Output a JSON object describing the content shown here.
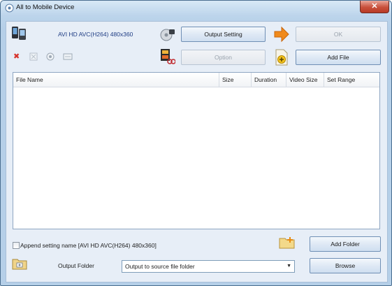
{
  "window": {
    "title": "All to Mobile Device",
    "close_glyph": "✕"
  },
  "toolbar": {
    "profile_name": "AVI HD AVC(H264) 480x360",
    "output_setting_label": "Output Setting",
    "ok_label": "OK",
    "option_label": "Option",
    "add_file_label": "Add File",
    "remove_icon": "✖"
  },
  "file_list": {
    "columns": [
      "File Name",
      "Size",
      "Duration",
      "Video Size",
      "Set Range"
    ],
    "rows": []
  },
  "footer": {
    "append_setting_label": "Append setting name [AVI HD AVC(H264) 480x360]",
    "append_setting_checked": false,
    "add_folder_label": "Add Folder",
    "output_folder_label": "Output Folder",
    "output_folder_value": "Output to source file folder",
    "browse_label": "Browse",
    "dropdown_arrow": "▼"
  },
  "colors": {
    "accent": "#1f3d84",
    "arrow_orange": "#f08a1c",
    "close_red": "#c8503b"
  },
  "icons": [
    "app-icon",
    "mobile-devices-icon",
    "settings-disc-icon",
    "next-arrow-icon",
    "film-cut-icon",
    "add-file-icon",
    "remove-icon",
    "clear-icon",
    "preview-icon",
    "info-icon",
    "add-folder-icon",
    "open-folder-icon"
  ]
}
